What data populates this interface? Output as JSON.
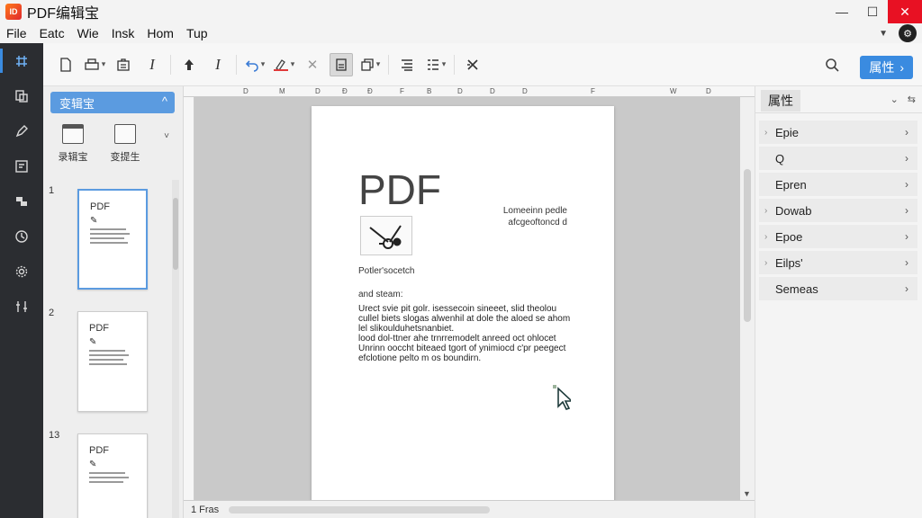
{
  "app": {
    "logo_text": "ID",
    "title": "PDF编辑宝"
  },
  "window_controls": {
    "minimize": "—",
    "maximize": "☐",
    "close": "✕"
  },
  "menu": {
    "items": [
      "File",
      "Eatc",
      "Wie",
      "Insk",
      "Hom",
      "Tup"
    ],
    "dropdown_glyph": "▼",
    "account_glyph": "⚙"
  },
  "toolbar": {
    "search_glyph": "🔍",
    "property_button": {
      "label": "属性",
      "arrow": "›"
    }
  },
  "left_panel": {
    "header": "变辑宝",
    "header_chevron": "^",
    "tools": [
      {
        "label": "录辑宝"
      },
      {
        "label": "变提生"
      }
    ],
    "tools_caret": "˅",
    "pages": [
      {
        "num": "1",
        "title": "PDF"
      },
      {
        "num": "2",
        "title": "PDF"
      },
      {
        "num": "13",
        "title": "PDF"
      }
    ]
  },
  "ruler": {
    "labels": [
      "D",
      "M",
      "D",
      "Ð",
      "Ð",
      "F",
      "B",
      "D",
      "D",
      "D",
      "F",
      "W",
      "D"
    ]
  },
  "document": {
    "title": "PDF",
    "side_text": [
      "Lomeeinn pedle",
      "afcgeoftoncd d"
    ],
    "caption": "Potler'socetch",
    "subheading": "and steam:",
    "body": [
      "Urect svie pit golr. isessecoin sineeet, slid theolou",
      "cullel biets slogas alwenhil at dole the aloed se ahom",
      "lel slikoulduhetsnanbiet.",
      "lood dol-ttner ahe trnrremodelt anreed oct ohlocet",
      "Unrinn ooccht biteaed tgort of ynimiocd c'pr peegect",
      "efclotione pelto m os boundirn."
    ]
  },
  "status": {
    "page_label": "1  Fras"
  },
  "right_panel": {
    "title": "属性",
    "header_controls": [
      "⌄",
      "⇆"
    ],
    "items": [
      {
        "label": "Epie",
        "left": "›",
        "right": "›"
      },
      {
        "label": "Q",
        "left": "",
        "right": "›"
      },
      {
        "label": "Epren",
        "left": "",
        "right": "›"
      },
      {
        "label": "Dowab",
        "left": "›",
        "right": "›"
      },
      {
        "label": "Epoe",
        "left": "›",
        "right": "›"
      },
      {
        "label": "Eilps'",
        "left": "›",
        "right": "›"
      },
      {
        "label": "Semeas",
        "left": "",
        "right": "›"
      }
    ]
  }
}
